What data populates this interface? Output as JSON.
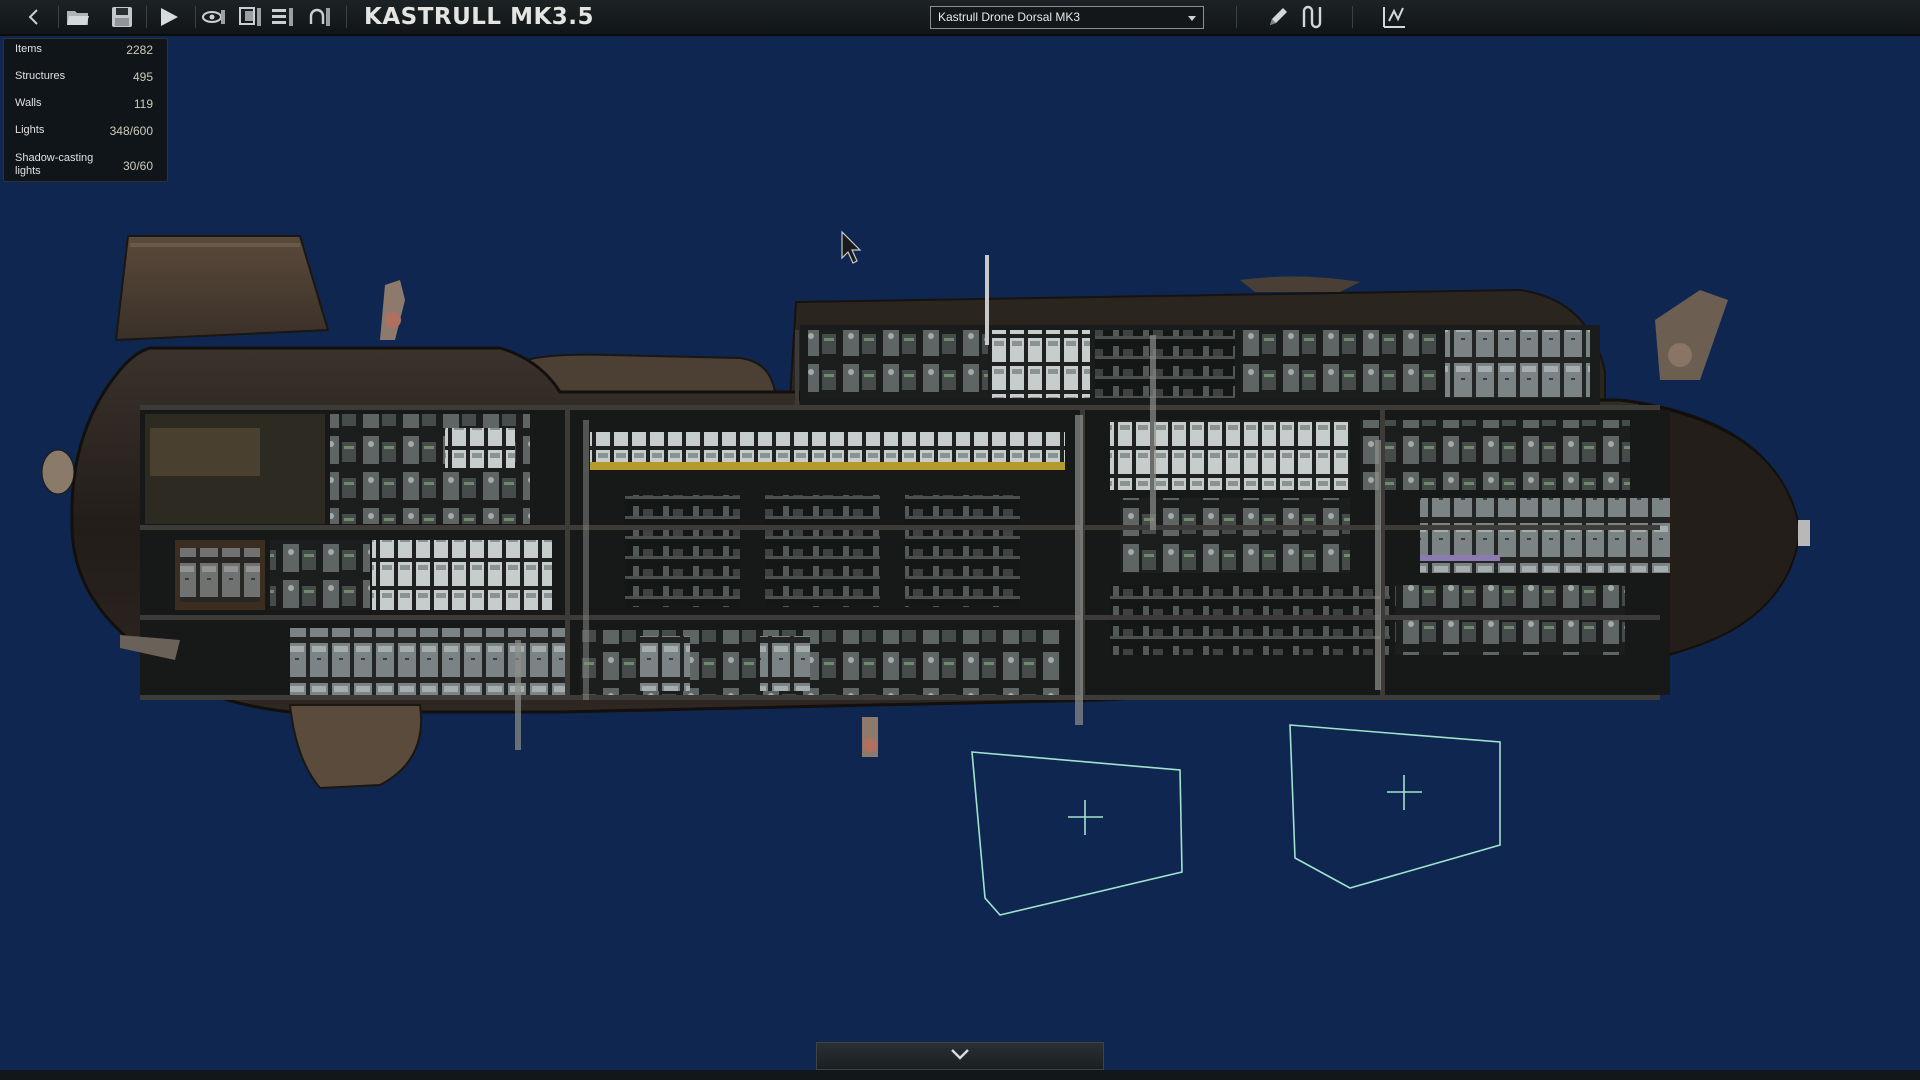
{
  "toolbar": {
    "icons": [
      "back-icon",
      "open-folder-icon",
      "save-icon",
      "play-icon",
      "visibility-icon",
      "layers-icon",
      "entity-list-icon",
      "undo-history-icon",
      "pencil-icon",
      "wiring-icon",
      "waypoint-icon"
    ],
    "submarine_title": "KASTRULL MK3.5",
    "submarine_selector": {
      "selected": "Kastrull Drone Dorsal MK3"
    }
  },
  "stats": {
    "rows": [
      {
        "label": "Items",
        "value": "2282"
      },
      {
        "label": "Structures",
        "value": "495"
      },
      {
        "label": "Walls",
        "value": "119"
      },
      {
        "label": "Lights",
        "value": "348/600"
      },
      {
        "label": "Shadow-casting lights",
        "value": "30/60"
      }
    ]
  },
  "colors": {
    "background": "#0f2750",
    "hull": "#2a2420",
    "interior": "#1b1c1c",
    "dock_outline": "#9fe3cf"
  },
  "bottom": {
    "collapse_icon": "chevron-down-icon"
  }
}
